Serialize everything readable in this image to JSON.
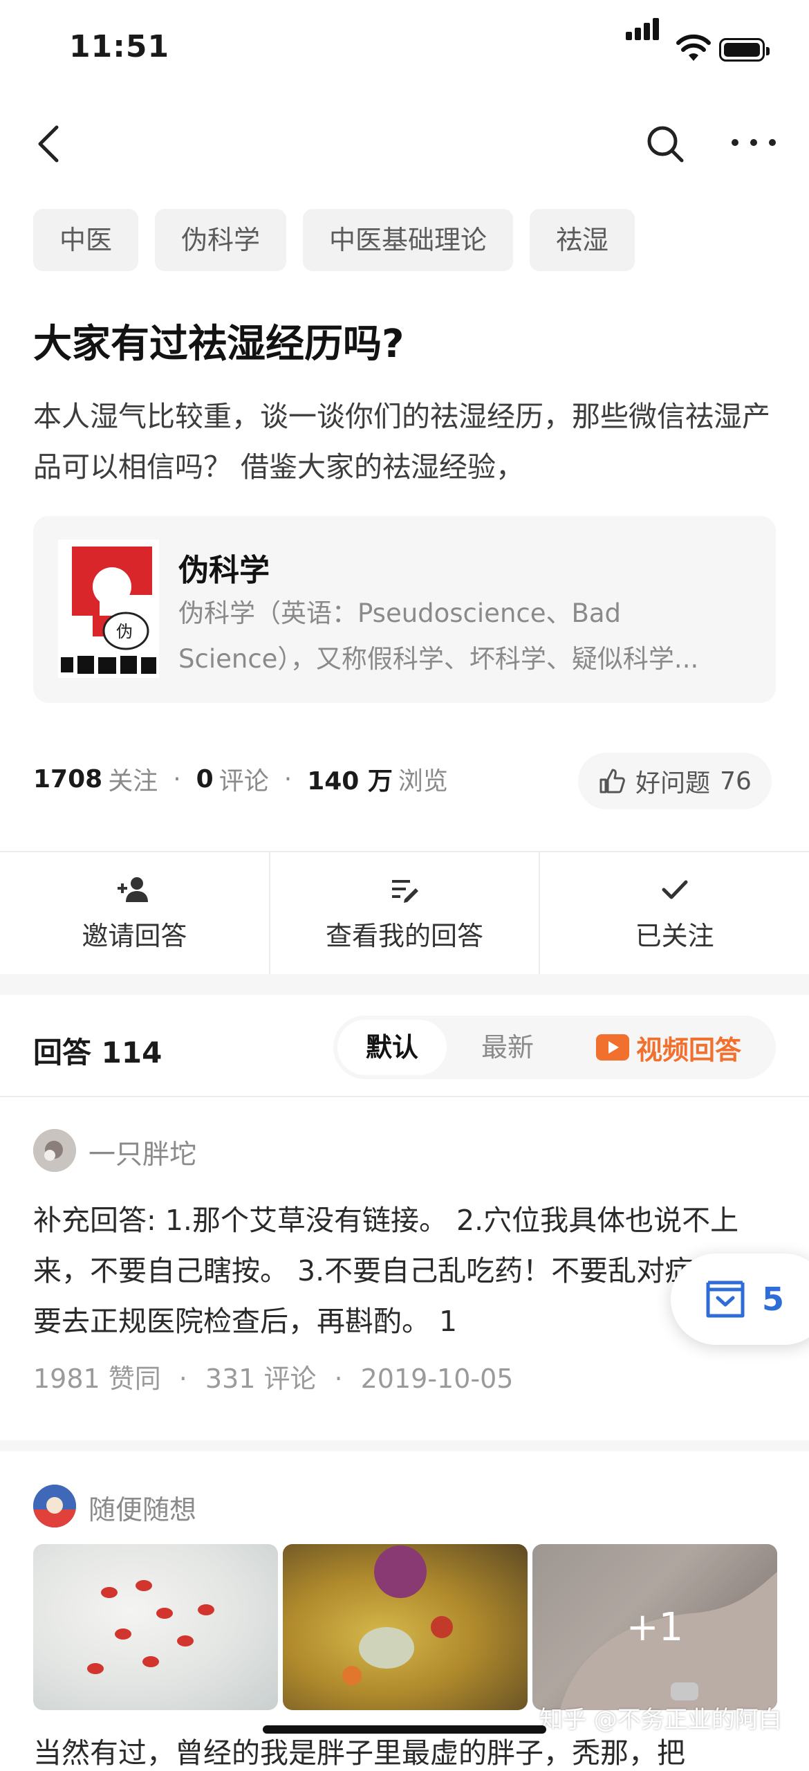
{
  "status_bar": {
    "time": "11:51"
  },
  "nav": {
    "back_icon": "chevron-left-icon",
    "search_icon": "search-icon",
    "more_icon": "more-horizontal-icon"
  },
  "tags": [
    "中医",
    "伪科学",
    "中医基础理论",
    "祛湿"
  ],
  "question": {
    "title": "大家有过祛湿经历吗?",
    "description": "本人湿气比较重，谈一谈你们的祛湿经历，那些微信祛湿产品可以相信吗？ 借鉴大家的祛湿经验，"
  },
  "topic_card": {
    "title": "伪科学",
    "description": "伪科学（英语：Pseudoscience、Bad Science），又称假科学、坏科学、疑似科学...",
    "logo_text": "伪"
  },
  "stats": {
    "followers_value": "1708",
    "followers_label": "关注",
    "comments_value": "0",
    "comments_label": "评论",
    "views_value": "140 万",
    "views_label": "浏览",
    "good_question_label": "好问题",
    "good_question_count": "76"
  },
  "actions": [
    {
      "label": "邀请回答",
      "icon": "add-user-icon"
    },
    {
      "label": "查看我的回答",
      "icon": "edit-list-icon"
    },
    {
      "label": "已关注",
      "icon": "check-icon"
    }
  ],
  "answers": {
    "header": "回答 114",
    "sort_default": "默认",
    "sort_new": "最新",
    "sort_video": "视频回答"
  },
  "answer1": {
    "author": "一只胖坨",
    "text": "补充回答: 1.那个艾草没有链接。 2.穴位我具体也说不上来，不要自己瞎按。 3.不要自己乱吃药！不要乱对症状，需要去正规医院检查后，再斟酌。 1",
    "likes": "1981 赞同",
    "comments": "331 评论",
    "date": "2019-10-05"
  },
  "floating_collect": {
    "count": "5",
    "icon": "collection-box-icon"
  },
  "answer2": {
    "author": "随便随想",
    "extra_photos": "+1",
    "text_preview": "当然有过，曾经的我是胖子里最虚的胖子，秃那，把"
  },
  "watermark": "知乎 @不务正业的阿白",
  "colors": {
    "accent_orange": "#f1702d",
    "accent_blue": "#2e6dd6",
    "tag_bg": "#f2f2f2",
    "muted_text": "#8a8a8a"
  }
}
